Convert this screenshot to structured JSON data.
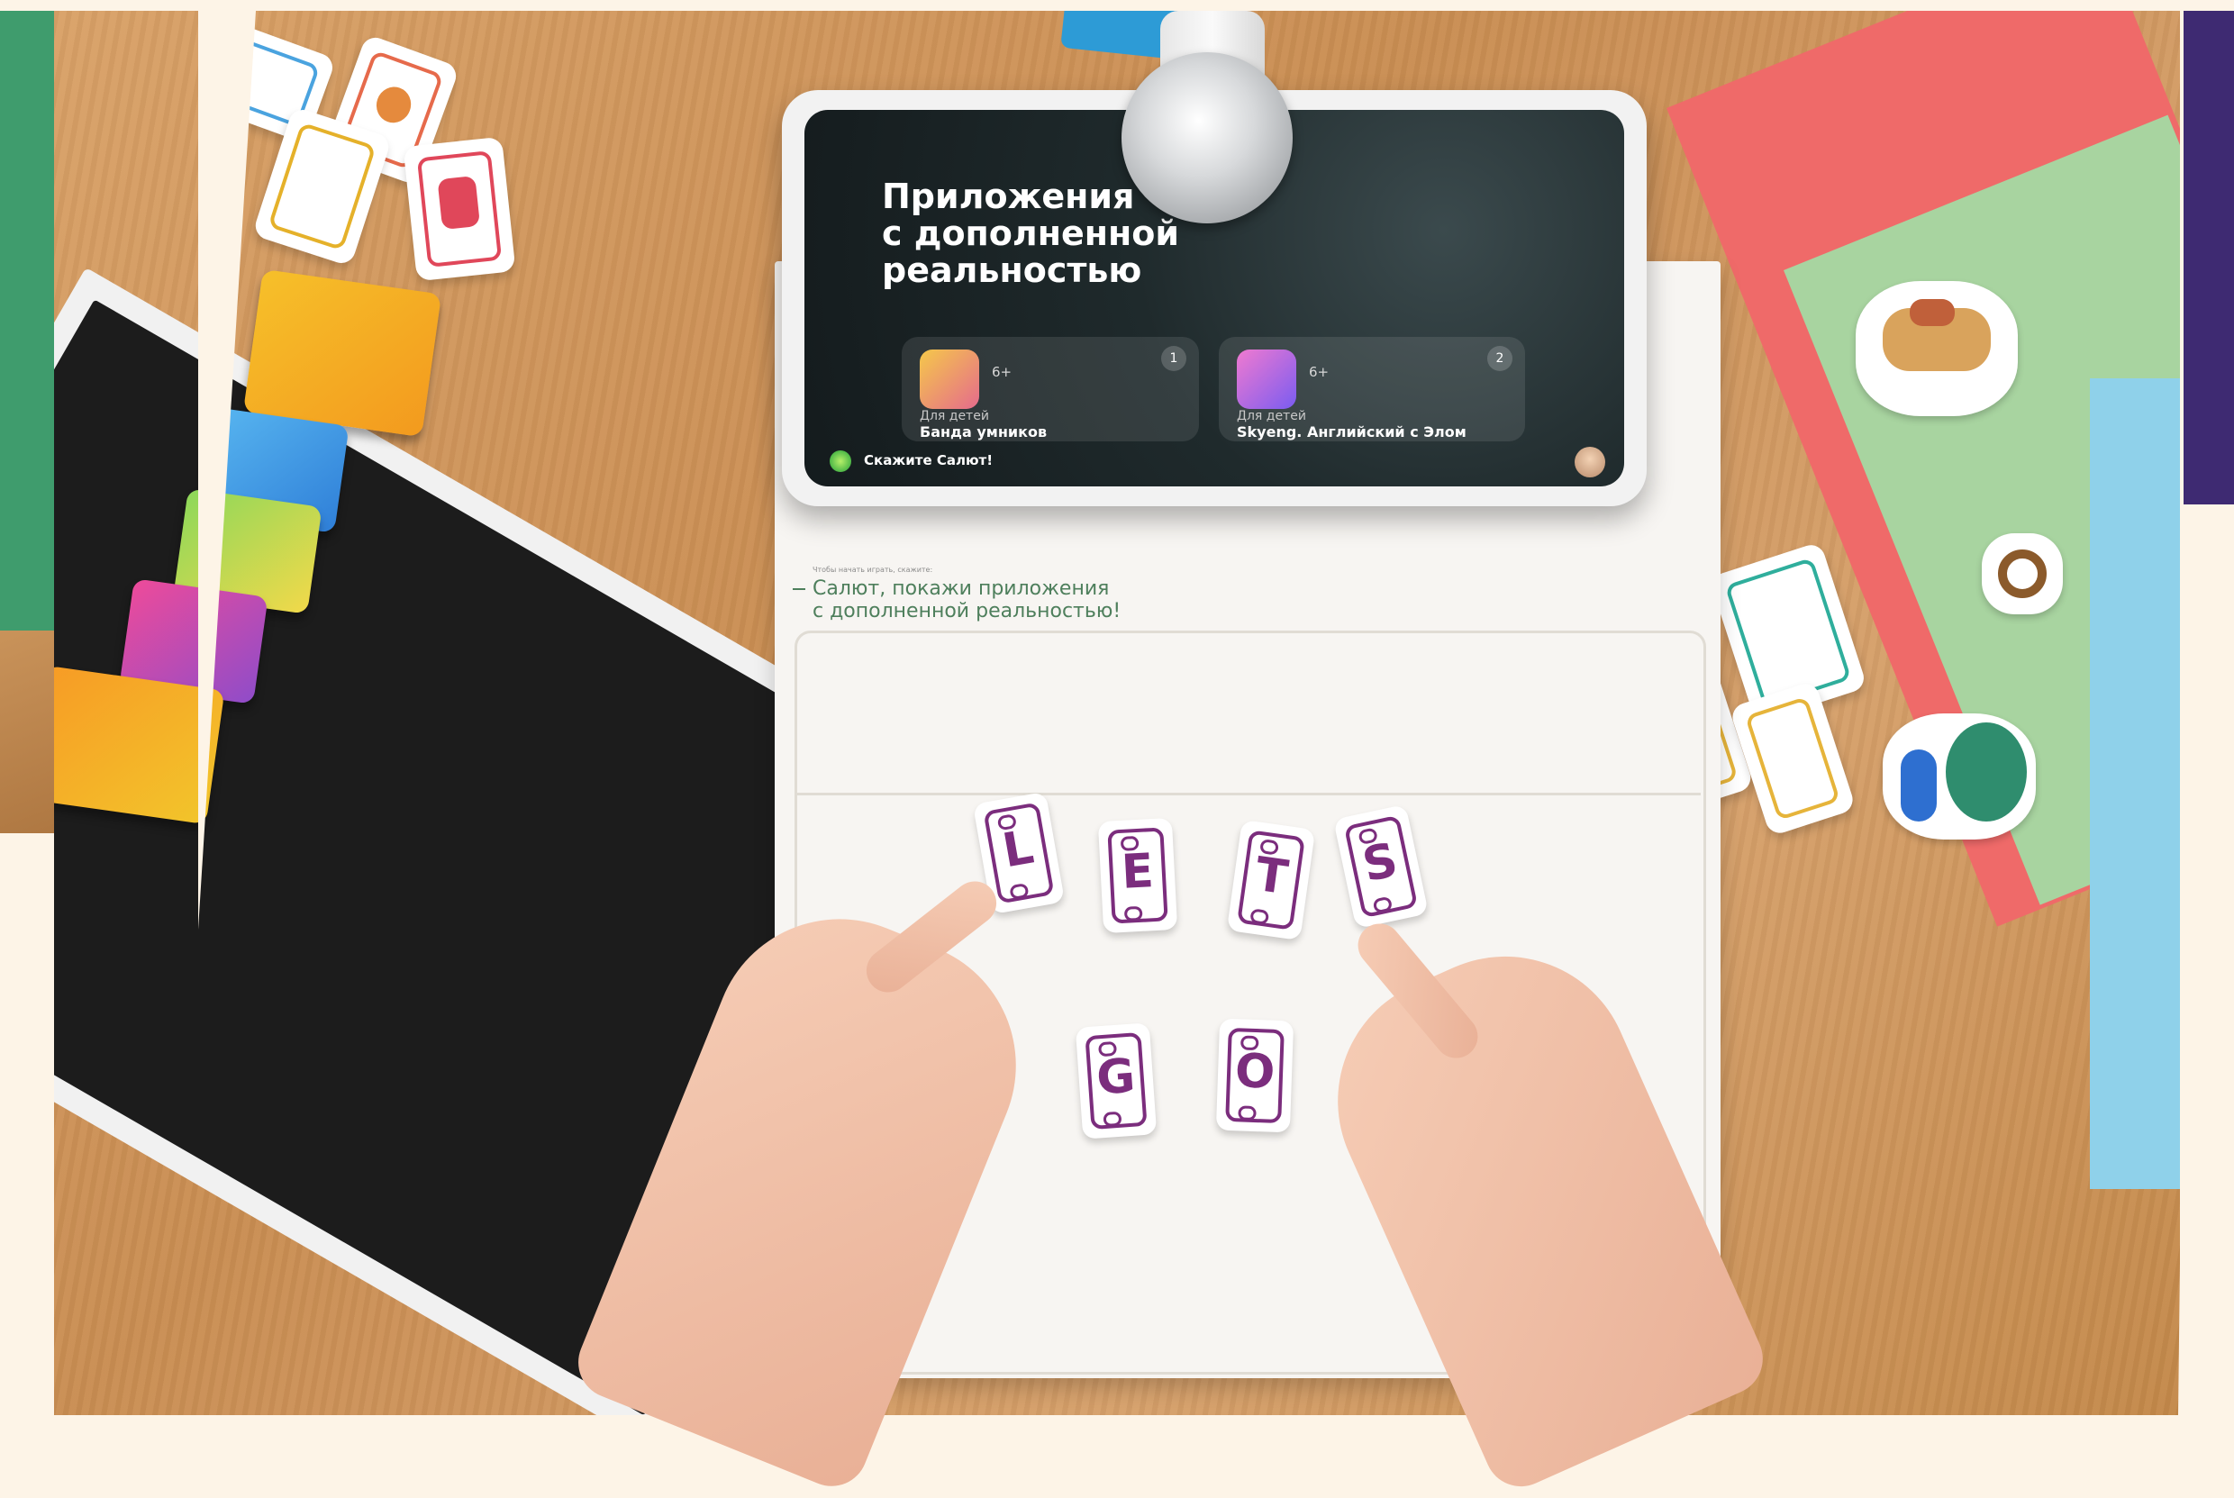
{
  "screen": {
    "title_line1": "Приложения",
    "title_line2": "с дополненной",
    "title_line3": "реальностью",
    "apps": [
      {
        "age": "6+",
        "number": "1",
        "category": "Для детей",
        "name": "Банда умников"
      },
      {
        "age": "6+",
        "number": "2",
        "category": "Для детей",
        "name": "Skyeng. Английский с Элом"
      }
    ],
    "assistant_prompt": "Скажите Салют!"
  },
  "mat": {
    "hint_small": "Чтобы начать играть, скажите:",
    "hint_line1": "Салют, покажи приложения",
    "hint_line2": "с дополненной реальностью!"
  },
  "letters": [
    "L",
    "E",
    "T",
    "S",
    "G",
    "O"
  ],
  "colors": {
    "left_panel": "#3f9c6d",
    "right_panel": "#3e2a72",
    "letter_purple": "#7b2d7d",
    "background": "#fdf4e7"
  }
}
